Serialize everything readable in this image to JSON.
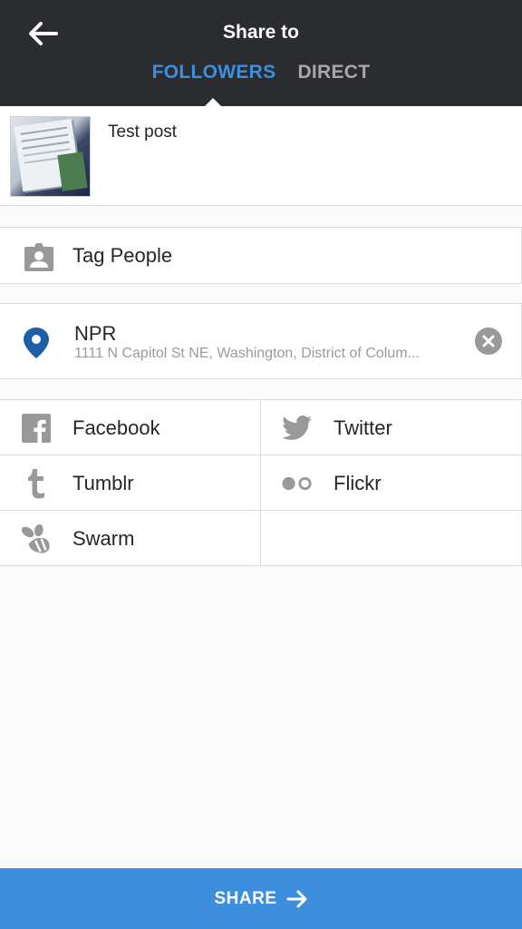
{
  "header": {
    "title": "Share to",
    "tabs": [
      {
        "label": "FOLLOWERS",
        "active": true
      },
      {
        "label": "DIRECT",
        "active": false
      }
    ]
  },
  "post": {
    "caption": "Test post"
  },
  "tag_people": {
    "label": "Tag People"
  },
  "location": {
    "name": "NPR",
    "address": "1111 N Capitol St NE, Washington, District of Colum..."
  },
  "share_services": [
    {
      "label": "Facebook",
      "icon": "facebook-icon"
    },
    {
      "label": "Twitter",
      "icon": "twitter-icon"
    },
    {
      "label": "Tumblr",
      "icon": "tumblr-icon"
    },
    {
      "label": "Flickr",
      "icon": "flickr-icon"
    },
    {
      "label": "Swarm",
      "icon": "swarm-icon"
    }
  ],
  "share_button": {
    "label": "SHARE"
  },
  "colors": {
    "header_bg": "#2b2c30",
    "accent": "#3d8fe0",
    "location_pin": "#1d5ea8",
    "icon_gray": "#9a9a9a"
  }
}
